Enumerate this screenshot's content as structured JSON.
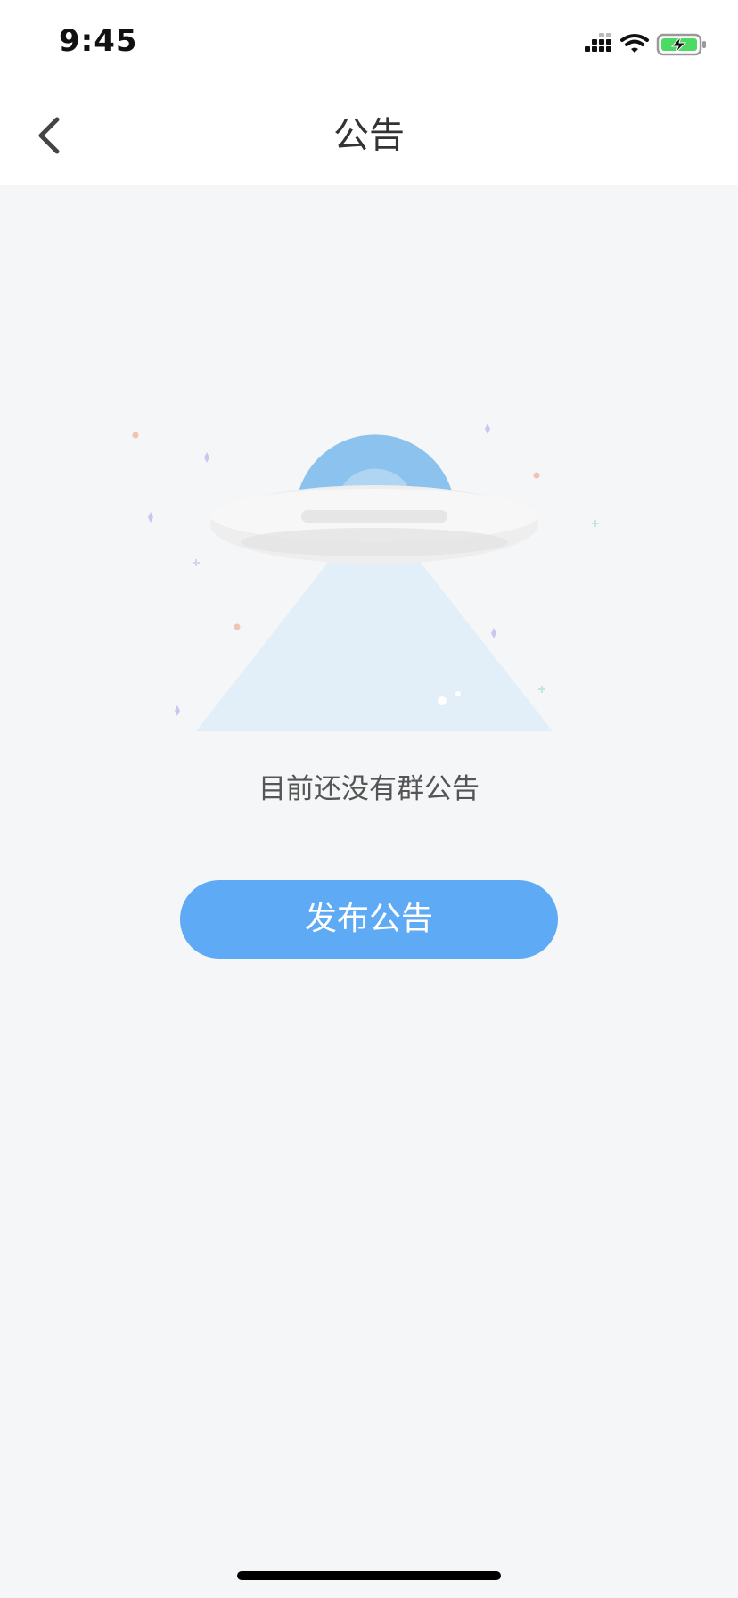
{
  "status_bar": {
    "time": "9:45",
    "icons": [
      "cellular-signal-icon",
      "wifi-icon",
      "battery-charging-icon"
    ]
  },
  "nav": {
    "back_icon": "chevron-left-icon",
    "title": "公告"
  },
  "empty_state": {
    "illustration": "ufo-illustration",
    "message": "目前还没有群公告",
    "action_label": "发布公告"
  },
  "colors": {
    "accent": "#5faaf5",
    "background": "#f5f6f7",
    "header_background": "#ffffff",
    "title_text": "#333333",
    "message_text": "#555555",
    "battery_green": "#4cd964"
  }
}
